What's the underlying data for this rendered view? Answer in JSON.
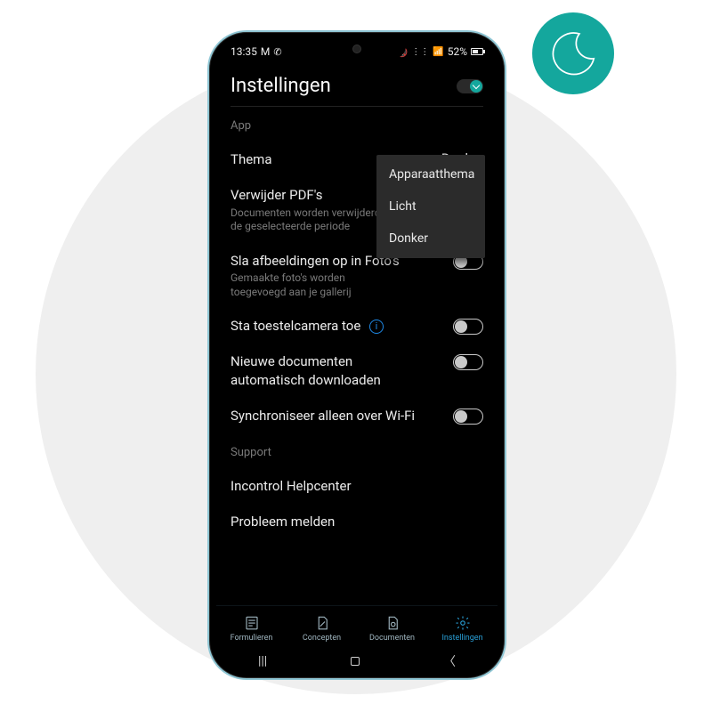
{
  "statusbar": {
    "time": "13:35",
    "battery": "52%"
  },
  "page": {
    "title": "Instellingen"
  },
  "sections": {
    "app_label": "App",
    "support_label": "Support"
  },
  "theme": {
    "label": "Thema",
    "value": "Donker",
    "options": [
      "Apparaatthema",
      "Licht",
      "Donker"
    ]
  },
  "pdf": {
    "label": "Verwijder PDF's",
    "sub": "Documenten worden verwijderd na de geselecteerde periode"
  },
  "save_photos": {
    "label": "Sla afbeeldingen op in Foto's",
    "sub": "Gemaakte foto's worden toegevoegd aan je gallerij"
  },
  "camera": {
    "label": "Sta toestelcamera toe"
  },
  "autodl": {
    "label": "Nieuwe documenten automatisch downloaden"
  },
  "wifi": {
    "label": "Synchroniseer alleen over Wi-Fi"
  },
  "support": {
    "help": "Incontrol Helpcenter",
    "problem": "Probleem melden"
  },
  "nav": {
    "forms": "Formulieren",
    "concepts": "Concepten",
    "docs": "Documenten",
    "settings": "Instellingen"
  }
}
